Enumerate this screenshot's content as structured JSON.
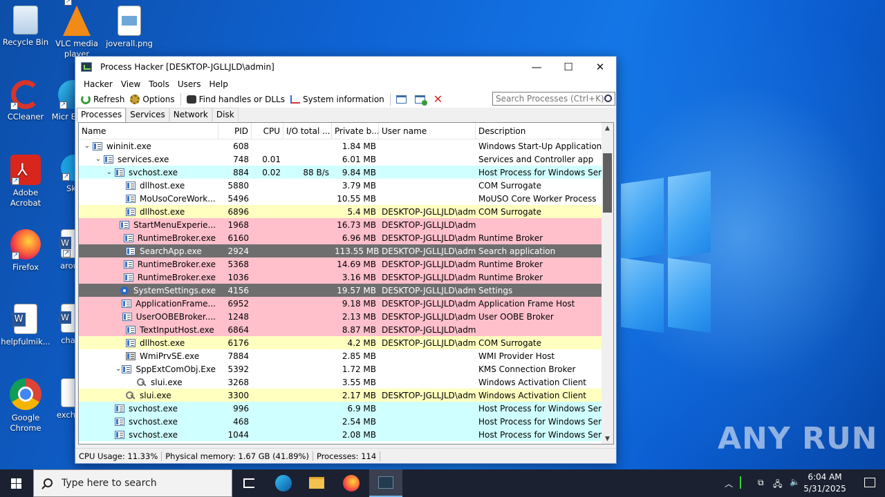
{
  "desktop": {
    "icons": [
      {
        "label": "Recycle Bin",
        "icon": "recycle-bin-icon"
      },
      {
        "label": "VLC media player",
        "icon": "vlc-icon"
      },
      {
        "label": "joverall.png",
        "icon": "image-file-icon"
      },
      {
        "label": "CCleaner",
        "icon": "ccleaner-icon"
      },
      {
        "label": "Micr Ed",
        "icon": "edge-icon"
      },
      {
        "label": "Adobe Acrobat",
        "icon": "acrobat-icon"
      },
      {
        "label": "Sk",
        "icon": "skype-icon"
      },
      {
        "label": "Firefox",
        "icon": "firefox-icon"
      },
      {
        "label": "arou",
        "icon": "word-doc-icon"
      },
      {
        "label": "helpfulmik...",
        "icon": "word-doc-icon"
      },
      {
        "label": "chai",
        "icon": "word-doc-icon"
      },
      {
        "label": "Google Chrome",
        "icon": "chrome-icon"
      },
      {
        "label": "excha",
        "icon": "file-icon"
      }
    ],
    "watermark": "ANY RUN"
  },
  "window": {
    "title": "Process Hacker [DESKTOP-JGLLJLD\\admin]",
    "minimize": "—",
    "maximize": "☐",
    "close": "✕"
  },
  "menu": [
    "Hacker",
    "View",
    "Tools",
    "Users",
    "Help"
  ],
  "toolbar": {
    "refresh": "Refresh",
    "options": "Options",
    "find": "Find handles or DLLs",
    "sysinfo": "System information",
    "search_placeholder": "Search Processes (Ctrl+K)"
  },
  "tabs": [
    "Processes",
    "Services",
    "Network",
    "Disk"
  ],
  "columns": [
    "Name",
    "PID",
    "CPU",
    "I/O total ...",
    "Private b...",
    "User name",
    "Description"
  ],
  "rows": [
    {
      "indent": 0,
      "toggle": "⌄",
      "icon": "app",
      "name": "wininit.exe",
      "pid": "608",
      "cpu": "",
      "io": "",
      "priv": "1.84 MB",
      "user": "",
      "desc": "Windows Start-Up Application",
      "bg": "white"
    },
    {
      "indent": 1,
      "toggle": "⌄",
      "icon": "app",
      "name": "services.exe",
      "pid": "748",
      "cpu": "0.01",
      "io": "",
      "priv": "6.01 MB",
      "user": "",
      "desc": "Services and Controller app",
      "bg": "white"
    },
    {
      "indent": 2,
      "toggle": "⌄",
      "icon": "app",
      "name": "svchost.exe",
      "pid": "884",
      "cpu": "0.02",
      "io": "88 B/s",
      "priv": "9.84 MB",
      "user": "",
      "desc": "Host Process for Windows Ser...",
      "bg": "service"
    },
    {
      "indent": 3,
      "toggle": "",
      "icon": "app",
      "name": "dllhost.exe",
      "pid": "5880",
      "cpu": "",
      "io": "",
      "priv": "3.79 MB",
      "user": "",
      "desc": "COM Surrogate",
      "bg": "white"
    },
    {
      "indent": 3,
      "toggle": "",
      "icon": "app",
      "name": "MoUsoCoreWork...",
      "pid": "5496",
      "cpu": "",
      "io": "",
      "priv": "10.55 MB",
      "user": "",
      "desc": "MoUSO Core Worker Process",
      "bg": "white"
    },
    {
      "indent": 3,
      "toggle": "",
      "icon": "app",
      "name": "dllhost.exe",
      "pid": "6896",
      "cpu": "",
      "io": "",
      "priv": "5.4 MB",
      "user": "DESKTOP-JGLLJLD\\admi",
      "desc": "COM Surrogate",
      "bg": "owned"
    },
    {
      "indent": 3,
      "toggle": "",
      "icon": "app",
      "name": "StartMenuExperie...",
      "pid": "1968",
      "cpu": "",
      "io": "",
      "priv": "16.73 MB",
      "user": "DESKTOP-JGLLJLD\\admi",
      "desc": "",
      "bg": "pink"
    },
    {
      "indent": 3,
      "toggle": "",
      "icon": "app",
      "name": "RuntimeBroker.exe",
      "pid": "6160",
      "cpu": "",
      "io": "",
      "priv": "6.96 MB",
      "user": "DESKTOP-JGLLJLD\\admi",
      "desc": "Runtime Broker",
      "bg": "pink"
    },
    {
      "indent": 3,
      "toggle": "",
      "icon": "app",
      "name": "SearchApp.exe",
      "pid": "2924",
      "cpu": "",
      "io": "",
      "priv": "113.55 MB",
      "user": "DESKTOP-JGLLJLD\\admi",
      "desc": "Search application",
      "bg": "dark"
    },
    {
      "indent": 3,
      "toggle": "",
      "icon": "app",
      "name": "RuntimeBroker.exe",
      "pid": "5368",
      "cpu": "",
      "io": "",
      "priv": "14.69 MB",
      "user": "DESKTOP-JGLLJLD\\admi",
      "desc": "Runtime Broker",
      "bg": "pink"
    },
    {
      "indent": 3,
      "toggle": "",
      "icon": "app",
      "name": "RuntimeBroker.exe",
      "pid": "1036",
      "cpu": "",
      "io": "",
      "priv": "3.16 MB",
      "user": "DESKTOP-JGLLJLD\\admi",
      "desc": "Runtime Broker",
      "bg": "pink"
    },
    {
      "indent": 3,
      "toggle": "",
      "icon": "gear",
      "name": "SystemSettings.exe",
      "pid": "4156",
      "cpu": "",
      "io": "",
      "priv": "19.57 MB",
      "user": "DESKTOP-JGLLJLD\\admi",
      "desc": "Settings",
      "bg": "dark"
    },
    {
      "indent": 3,
      "toggle": "",
      "icon": "app",
      "name": "ApplicationFrame...",
      "pid": "6952",
      "cpu": "",
      "io": "",
      "priv": "9.18 MB",
      "user": "DESKTOP-JGLLJLD\\admi",
      "desc": "Application Frame Host",
      "bg": "pink"
    },
    {
      "indent": 3,
      "toggle": "",
      "icon": "app",
      "name": "UserOOBEBroker....",
      "pid": "1248",
      "cpu": "",
      "io": "",
      "priv": "2.13 MB",
      "user": "DESKTOP-JGLLJLD\\admi",
      "desc": "User OOBE Broker",
      "bg": "pink"
    },
    {
      "indent": 3,
      "toggle": "",
      "icon": "app",
      "name": "TextInputHost.exe",
      "pid": "6864",
      "cpu": "",
      "io": "",
      "priv": "8.87 MB",
      "user": "DESKTOP-JGLLJLD\\admi",
      "desc": "",
      "bg": "pink"
    },
    {
      "indent": 3,
      "toggle": "",
      "icon": "app",
      "name": "dllhost.exe",
      "pid": "6176",
      "cpu": "",
      "io": "",
      "priv": "4.2 MB",
      "user": "DESKTOP-JGLLJLD\\admi",
      "desc": "COM Surrogate",
      "bg": "owned"
    },
    {
      "indent": 3,
      "toggle": "",
      "icon": "wmi",
      "name": "WmiPrvSE.exe",
      "pid": "7884",
      "cpu": "",
      "io": "",
      "priv": "2.85 MB",
      "user": "",
      "desc": "WMI Provider Host",
      "bg": "white"
    },
    {
      "indent": 3,
      "toggle": "⌄",
      "icon": "app",
      "name": "SppExtComObj.Exe",
      "pid": "5392",
      "cpu": "",
      "io": "",
      "priv": "1.72 MB",
      "user": "",
      "desc": "KMS Connection Broker",
      "bg": "white"
    },
    {
      "indent": 4,
      "toggle": "",
      "icon": "key",
      "name": "slui.exe",
      "pid": "3268",
      "cpu": "",
      "io": "",
      "priv": "3.55 MB",
      "user": "",
      "desc": "Windows Activation Client",
      "bg": "white"
    },
    {
      "indent": 3,
      "toggle": "",
      "icon": "key",
      "name": "slui.exe",
      "pid": "3300",
      "cpu": "",
      "io": "",
      "priv": "2.17 MB",
      "user": "DESKTOP-JGLLJLD\\admi",
      "desc": "Windows Activation Client",
      "bg": "owned"
    },
    {
      "indent": 2,
      "toggle": "",
      "icon": "app",
      "name": "svchost.exe",
      "pid": "996",
      "cpu": "",
      "io": "",
      "priv": "6.9 MB",
      "user": "",
      "desc": "Host Process for Windows Ser...",
      "bg": "service"
    },
    {
      "indent": 2,
      "toggle": "",
      "icon": "app",
      "name": "svchost.exe",
      "pid": "468",
      "cpu": "",
      "io": "",
      "priv": "2.54 MB",
      "user": "",
      "desc": "Host Process for Windows Ser...",
      "bg": "service"
    },
    {
      "indent": 2,
      "toggle": "",
      "icon": "app",
      "name": "svchost.exe",
      "pid": "1044",
      "cpu": "",
      "io": "",
      "priv": "2.08 MB",
      "user": "",
      "desc": "Host Process for Windows Ser...",
      "bg": "service"
    }
  ],
  "status": {
    "cpu": "CPU Usage: 11.33%",
    "mem": "Physical memory: 1.67 GB (41.89%)",
    "procs": "Processes: 114"
  },
  "taskbar": {
    "search_placeholder": "Type here to search",
    "time": "6:04 AM",
    "date": "5/31/2025"
  }
}
